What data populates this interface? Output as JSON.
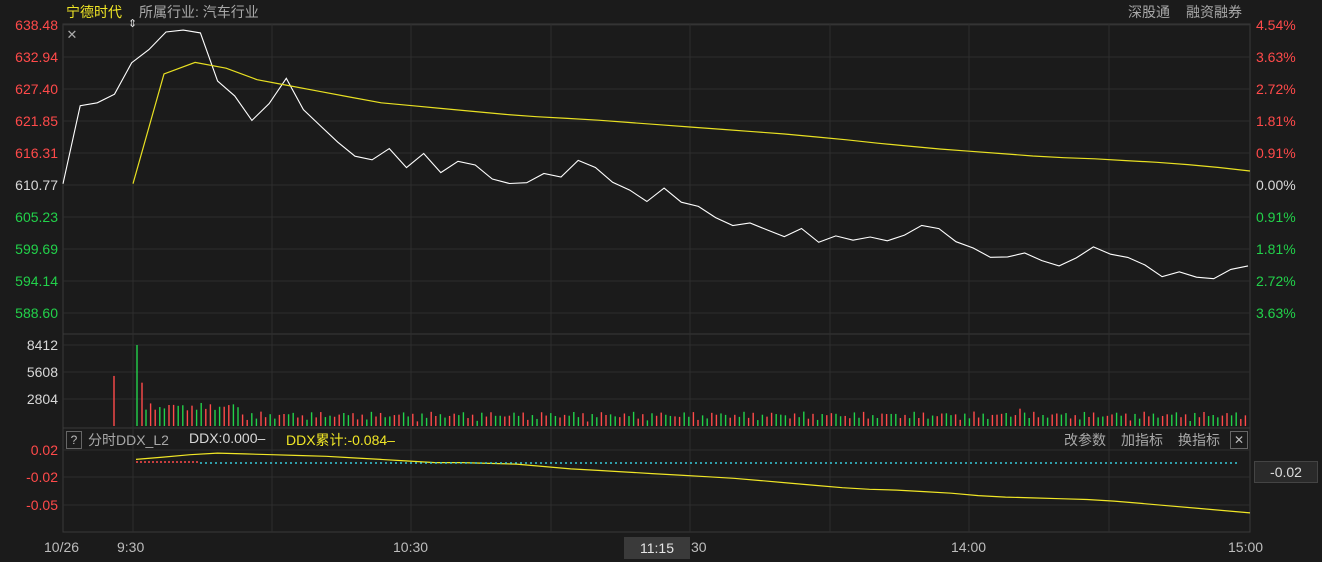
{
  "header": {
    "stock_name": "宁德时代",
    "industry_label": "所属行业: 汽车行业",
    "link_sgt": "深股通",
    "link_margin": "融资融券",
    "close_icon": "close-icon"
  },
  "price_axis": {
    "left": [
      "638.48",
      "632.94",
      "627.40",
      "621.85",
      "616.31",
      "610.77",
      "605.23",
      "599.69",
      "594.14",
      "588.60"
    ],
    "right": [
      "4.54%",
      "3.63%",
      "2.72%",
      "1.81%",
      "0.91%",
      "0.00%",
      "0.91%",
      "1.81%",
      "2.72%",
      "3.63%"
    ],
    "colors": [
      "red",
      "red",
      "red",
      "red",
      "red",
      "white",
      "green",
      "green",
      "green",
      "green"
    ]
  },
  "volume_axis": [
    "8412",
    "5608",
    "2804"
  ],
  "ddx_panel": {
    "help_label": "?",
    "indicator_name": "分时DDX_L2",
    "ddx_value": "DDX:0.000–",
    "ddx_cum": "DDX累计:-0.084–",
    "btn_params": "改参数",
    "btn_add": "加指标",
    "btn_switch": "换指标",
    "close_label": "✕",
    "axis": [
      "0.02",
      "-0.02",
      "-0.05"
    ],
    "current_value": "-0.02"
  },
  "time_axis": {
    "date": "10/26",
    "labels": [
      "9:30",
      "10:30",
      "11:15",
      "30",
      "14:00",
      "15:00"
    ],
    "cursor_time": "11:15"
  },
  "colors": {
    "background": "#1b1b1b",
    "grid": "#2e2e2e",
    "up": "#ff4a4a",
    "down": "#22d14a",
    "price_line": "#ffffff",
    "avg_line": "#e8e022",
    "ddx_line": "#f0e626",
    "ddx_dots": "#36c9d8"
  },
  "chart_data": {
    "type": "line",
    "prev_close": 610.77,
    "ylim": [
      588.6,
      638.48
    ],
    "x_labels": [
      "9:30",
      "10:30",
      "11:30/13:00",
      "14:00",
      "15:00"
    ],
    "series": [
      {
        "values": [
          611,
          624.5,
          625,
          626.5,
          632,
          634,
          637.5,
          637.5,
          637,
          629,
          626,
          622,
          625,
          629,
          624,
          621,
          618,
          616,
          615,
          617,
          614,
          616,
          613,
          615,
          614,
          612,
          611,
          611,
          613,
          612,
          615,
          614,
          611,
          610,
          608,
          610,
          608,
          607,
          605,
          604,
          604,
          603,
          602,
          603,
          601,
          602,
          601,
          602,
          601,
          602,
          604,
          603,
          601,
          600,
          598,
          598.5,
          599,
          597.5,
          597,
          598,
          600,
          599,
          598,
          597,
          595,
          595.5,
          595,
          594.5,
          596,
          597
        ]
      },
      {
        "values": [
          611,
          630,
          632,
          631,
          629,
          628,
          627,
          626,
          625,
          624.5,
          624,
          623.5,
          623,
          622.6,
          622.3,
          622,
          621.6,
          621.2,
          620.8,
          620.4,
          620,
          619.6,
          619.1,
          618.6,
          618,
          617.5,
          617,
          616.6,
          616.2,
          615.8,
          615.5,
          615.3,
          615,
          614.7,
          614.3,
          613.8,
          613.2
        ]
      }
    ],
    "volume": {
      "ylim": [
        0,
        8412
      ],
      "ticks": [
        2804,
        5608,
        8412
      ]
    },
    "ddx_cum": {
      "ylim": [
        -0.065,
        0.025
      ],
      "last": -0.084
    }
  }
}
